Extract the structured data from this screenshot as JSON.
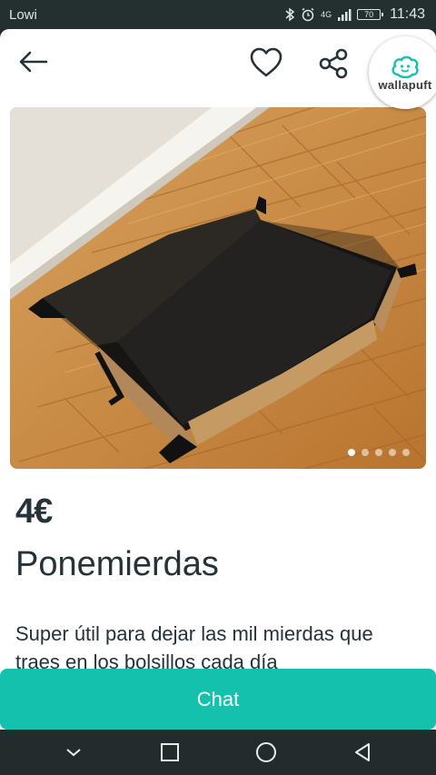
{
  "status_bar": {
    "carrier": "Lowi",
    "network": "4G",
    "battery": "70",
    "time": "11:43"
  },
  "toolbar": {
    "back_icon": "arrow-left-icon",
    "favorite_icon": "heart-outline-icon",
    "share_icon": "share-icon",
    "badge_text": "wallapuft"
  },
  "listing": {
    "photo_count": 5,
    "active_photo_index": 0,
    "price": "4€",
    "title": "Ponemierdas",
    "description": "Super útil para dejar las mil mierdas que traes en los bolsillos cada día"
  },
  "actions": {
    "chat_label": "Chat"
  },
  "nav": {
    "back_icon": "nav-back-triangle-icon",
    "home_icon": "nav-home-circle-icon",
    "recents_icon": "nav-recents-square-icon",
    "collapse_icon": "nav-collapse-chevron-icon"
  },
  "colors": {
    "accent": "#13c1ac",
    "text": "#253238",
    "status_bar": "#23302f",
    "nav_bar": "#232b2c"
  }
}
